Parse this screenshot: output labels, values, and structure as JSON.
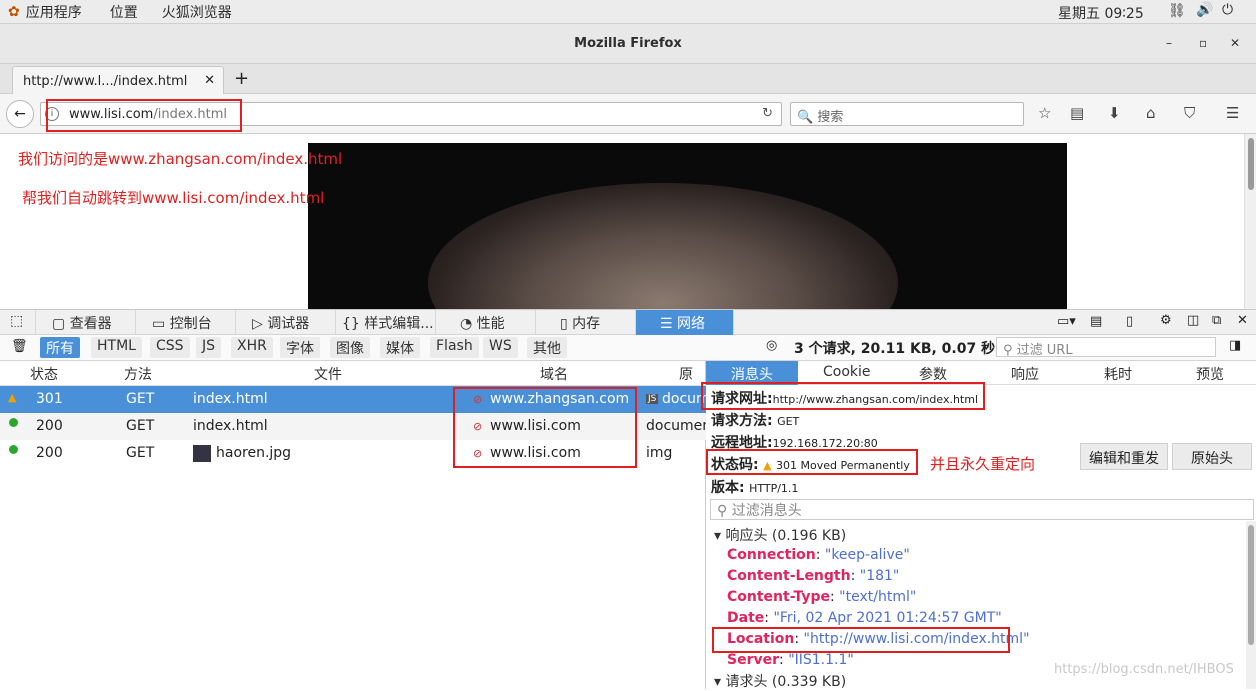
{
  "topbar": {
    "apps": "应用程序",
    "places": "位置",
    "browser": "火狐浏览器",
    "clock": "星期五 09∶25"
  },
  "window": {
    "title": "Mozilla Firefox",
    "minimize": "–",
    "maximize": "▫",
    "close": "✕"
  },
  "tab": {
    "label": "http://www.l.../index.html",
    "close": "✕",
    "new_tab": "+"
  },
  "nav": {
    "url_host": "www.lisi.com",
    "url_path": "/index.html",
    "search_placeholder": "搜索"
  },
  "page": {
    "note1": "我们访问的是www.zhangsan.com/index.html",
    "note2": "帮我们自动跳转到www.lisi.com/index.html"
  },
  "devtools": {
    "tools": [
      "查看器",
      "控制台",
      "调试器",
      "样式编辑...",
      "性能",
      "内存",
      "网络"
    ],
    "filters": [
      "所有",
      "HTML",
      "CSS",
      "JS",
      "XHR",
      "字体",
      "图像",
      "媒体",
      "Flash",
      "WS",
      "其他"
    ],
    "summary": "3 个请求, 20.11 KB, 0.07 秒",
    "filter_url_placeholder": "过滤 URL",
    "columns": {
      "status": "状态",
      "method": "方法",
      "file": "文件",
      "domain": "域名",
      "cause": "原因"
    },
    "rows": [
      {
        "status": "301",
        "method": "GET",
        "file": "index.html",
        "domain": "www.zhangsan.com",
        "cause": "docum"
      },
      {
        "status": "200",
        "method": "GET",
        "file": "index.html",
        "domain": "www.lisi.com",
        "cause": "documen"
      },
      {
        "status": "200",
        "method": "GET",
        "file": "haoren.jpg",
        "domain": "www.lisi.com",
        "cause": "img"
      }
    ],
    "detail_tabs": [
      "消息头",
      "Cookie",
      "参数",
      "响应",
      "耗时",
      "预览"
    ],
    "request_url_label": "请求网址:",
    "request_url": "http://www.zhangsan.com/index.html",
    "request_method_label": "请求方法:",
    "request_method": "GET",
    "remote_addr_label": "远程地址:",
    "remote_addr": "192.168.172.20:80",
    "status_code_label": "状态码:",
    "status_code": "301 Moved Permanently",
    "permanent_note": "并且永久重定向",
    "version_label": "版本:",
    "version": "HTTP/1.1",
    "edit_resend": "编辑和重发",
    "raw_headers": "原始头",
    "filter_headers_placeholder": "过滤消息头",
    "response_headers": "响应头 (0.196 KB)",
    "headers": [
      {
        "k": "Connection",
        "v": "\"keep-alive\""
      },
      {
        "k": "Content-Length",
        "v": "\"181\""
      },
      {
        "k": "Content-Type",
        "v": "\"text/html\""
      },
      {
        "k": "Date",
        "v": "\"Fri, 02 Apr 2021 01:24:57 GMT\""
      },
      {
        "k": "Location",
        "v": "\"http://www.lisi.com/index.html\""
      },
      {
        "k": "Server",
        "v": "\"IIS1.1.1\""
      }
    ],
    "request_headers": "请求头 (0.339 KB)"
  },
  "watermark": "https://blog.csdn.net/IHBOS",
  "colors": {
    "accent": "#4a90d9",
    "annotation": "#e02020",
    "header_key": "#e0245e",
    "header_value": "#4d6fd0"
  }
}
